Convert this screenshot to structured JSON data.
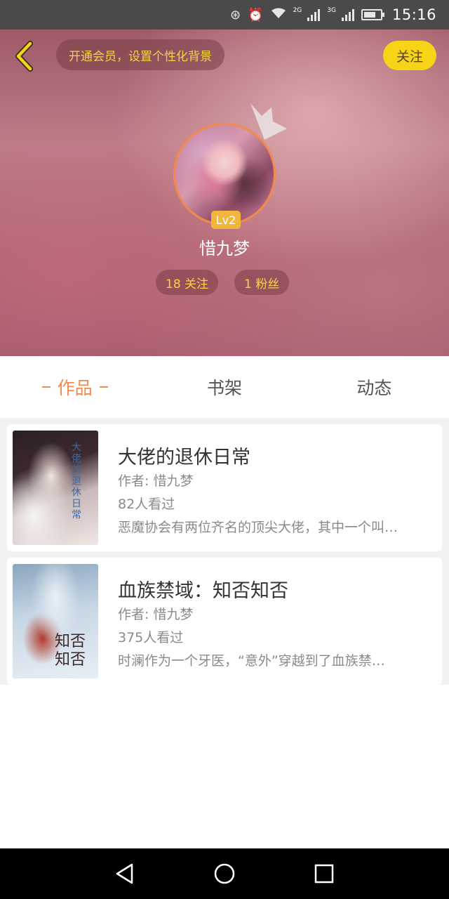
{
  "status_bar": {
    "time": "15:16",
    "net_2g": "2G",
    "net_3g": "3G"
  },
  "header": {
    "vip_banner": "开通会员，设置个性化背景",
    "follow_label": "关注",
    "level": "Lv2",
    "username": "惜九梦",
    "following": "18 关注",
    "fans": "1 粉丝"
  },
  "tabs": [
    {
      "label": "作品",
      "active": true
    },
    {
      "label": "书架",
      "active": false
    },
    {
      "label": "动态",
      "active": false
    }
  ],
  "books": [
    {
      "title": "大佬的退休日常",
      "author": "作者: 惜九梦",
      "views": "82人看过",
      "desc": "恶魔协会有两位齐名的顶尖大佬，其中一个叫…",
      "cover_text": "大佬的退休日常"
    },
    {
      "title": "血族禁域：知否知否",
      "author": "作者: 惜九梦",
      "views": "375人看过",
      "desc": "时澜作为一个牙医，“意外”穿越到了血族禁…",
      "cover_text": "知否知否"
    }
  ],
  "colors": {
    "accent": "#ef8a50",
    "follow_button": "#f7d416",
    "stat_text": "#f7d24a"
  }
}
